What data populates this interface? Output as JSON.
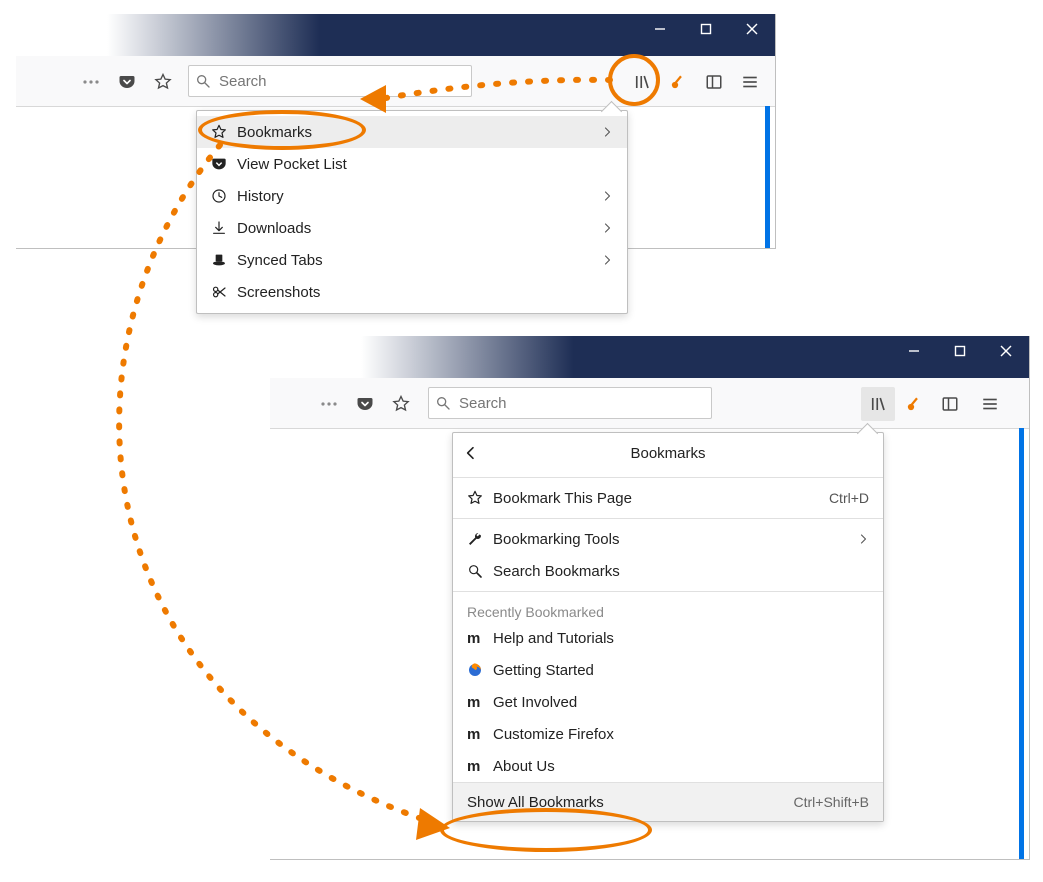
{
  "window1": {
    "search_placeholder": "Search",
    "library_menu": {
      "items": [
        {
          "label": "Bookmarks",
          "icon": "star-outline",
          "arrow": true,
          "highlight": true
        },
        {
          "label": "View Pocket List",
          "icon": "pocket",
          "arrow": false
        },
        {
          "label": "History",
          "icon": "clock",
          "arrow": true
        },
        {
          "label": "Downloads",
          "icon": "download",
          "arrow": true
        },
        {
          "label": "Synced Tabs",
          "icon": "synced-tabs",
          "arrow": true
        },
        {
          "label": "Screenshots",
          "icon": "screenshots",
          "arrow": false
        }
      ]
    }
  },
  "window2": {
    "search_placeholder": "Search",
    "bookmarks_menu": {
      "header": "Bookmarks",
      "top_items": [
        {
          "label": "Bookmark This Page",
          "icon": "star-outline",
          "shortcut": "Ctrl+D"
        }
      ],
      "tool_items": [
        {
          "label": "Bookmarking Tools",
          "icon": "wrench",
          "arrow": true
        },
        {
          "label": "Search Bookmarks",
          "icon": "magnifier"
        }
      ],
      "recent_label": "Recently Bookmarked",
      "recent_items": [
        {
          "label": "Help and Tutorials",
          "icon": "mozilla"
        },
        {
          "label": "Getting Started",
          "icon": "firefox"
        },
        {
          "label": "Get Involved",
          "icon": "mozilla"
        },
        {
          "label": "Customize Firefox",
          "icon": "mozilla"
        },
        {
          "label": "About Us",
          "icon": "mozilla"
        }
      ],
      "footer": {
        "label": "Show All Bookmarks",
        "shortcut": "Ctrl+Shift+B"
      }
    }
  }
}
